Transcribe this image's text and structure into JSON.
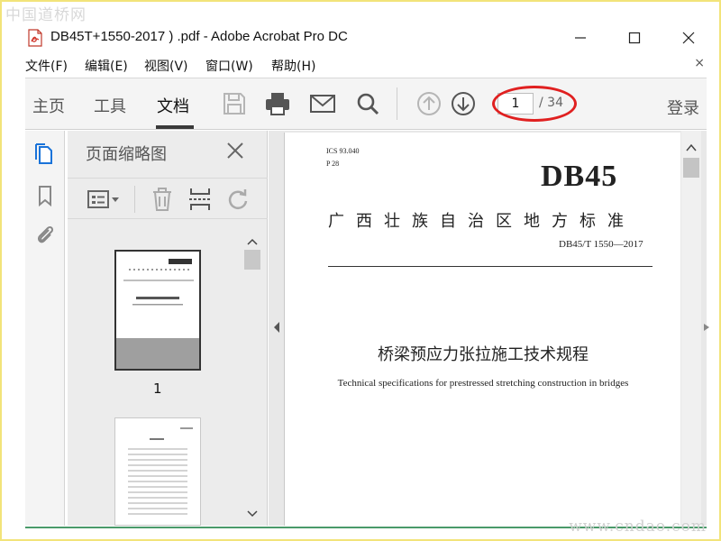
{
  "watermark": {
    "top": "中国道桥网",
    "bottom": "www.cndao.com"
  },
  "window": {
    "title": "DB45T+1550-2017 ) .pdf - Adobe Acrobat Pro DC"
  },
  "menu": {
    "items": [
      "文件(F)",
      "编辑(E)",
      "视图(V)",
      "窗口(W)",
      "帮助(H)"
    ],
    "close_glyph": "×"
  },
  "toolbar": {
    "tabs": [
      "主页",
      "工具",
      "文档"
    ],
    "active_tab": "文档",
    "icons": [
      "save-icon",
      "print-icon",
      "email-icon",
      "search-icon",
      "page-up-icon",
      "page-down-icon"
    ],
    "current_page": "1",
    "total_pages": "/ 34",
    "login_label": "登录",
    "highlight_color": "#e02020"
  },
  "rail": {
    "icons": [
      "page-thumbnails-icon",
      "bookmark-icon",
      "attachment-icon"
    ],
    "active_color": "#1a73d9"
  },
  "thumbnails": {
    "title": "页面缩略图",
    "tools": [
      "thumbnail-options-icon",
      "delete-icon",
      "insert-page-icon",
      "rotate-icon"
    ],
    "page1_label": "1"
  },
  "document": {
    "ics": "ICS 93.040",
    "pcode": "P 28",
    "code": "DB45",
    "org": "广西壮族自治区地方标准",
    "number": "DB45/T 1550—2017",
    "cn_title": "桥梁预应力张拉施工技术规程",
    "en_title": "Technical specifications for prestressed stretching construction in bridges"
  }
}
